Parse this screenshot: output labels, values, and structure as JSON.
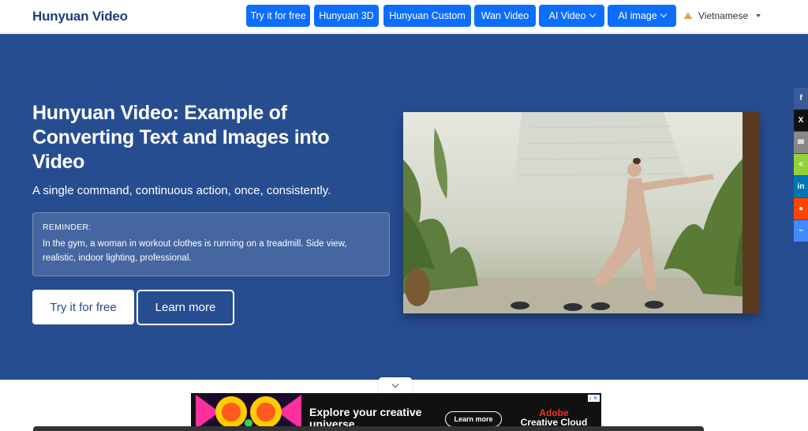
{
  "brand": "Hunyuan Video",
  "nav": {
    "items": [
      {
        "label": "Try it for free"
      },
      {
        "label": "Hunyuan 3D"
      },
      {
        "label": "Hunyuan Custom"
      },
      {
        "label": "Wan Video"
      },
      {
        "label": "AI Video"
      },
      {
        "label": "AI image"
      }
    ],
    "language": "Vietnamese"
  },
  "hero": {
    "title": "Hunyuan Video: Example of Converting Text and Images into Video",
    "subtitle": "A single command, continuous action, once, consistently.",
    "reminder_label": "REMINDER:",
    "reminder_text": "In the gym, a woman in workout clothes is running on a treadmill. Side view, realistic, indoor lighting, professional.",
    "try_label": "Try it for free",
    "learn_label": "Learn more"
  },
  "share": {
    "items": [
      {
        "icon": "facebook-icon",
        "glyph": "f",
        "color": "#3b5998"
      },
      {
        "icon": "x-icon",
        "glyph": "X",
        "color": "#111111"
      },
      {
        "icon": "email-icon",
        "glyph": "✉",
        "color": "#888888"
      },
      {
        "icon": "share-icon",
        "glyph": "<",
        "color": "#95d03a"
      },
      {
        "icon": "linkedin-icon",
        "glyph": "in",
        "color": "#0077b5"
      },
      {
        "icon": "reddit-icon",
        "glyph": "●",
        "color": "#ff4500"
      },
      {
        "icon": "messenger-icon",
        "glyph": "~",
        "color": "#448aff"
      }
    ]
  },
  "ad": {
    "headline": "Explore your creative universe.",
    "cta": "Learn more",
    "brand_top": "Adobe",
    "brand_bottom": "Creative Cloud",
    "corner": "i ✕"
  }
}
